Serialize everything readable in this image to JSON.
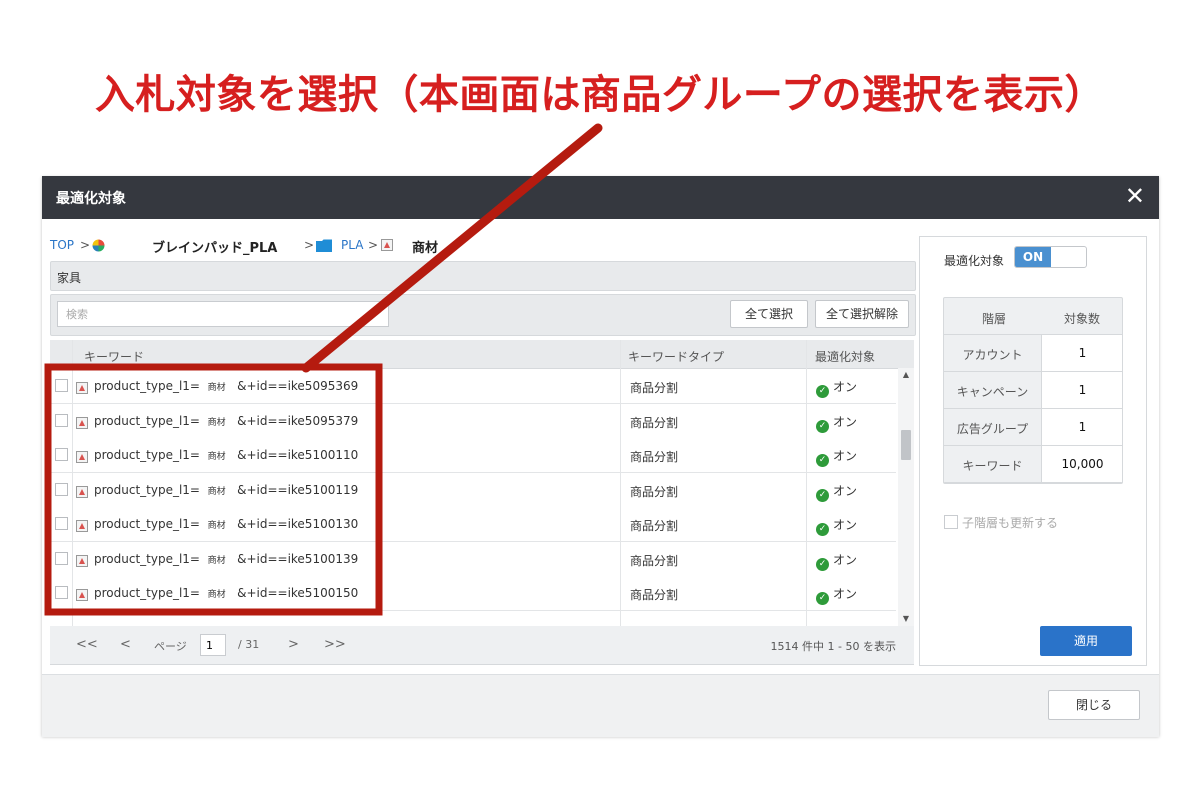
{
  "headline": {
    "text": "入札対象を選択（本画面は商品グループの選択を表示）",
    "color": "#d61f1f"
  },
  "modal": {
    "title": "最適化対象",
    "close_symbol": "✕"
  },
  "breadcrumb": {
    "top": "TOP",
    "sep": ">",
    "account": "ブレインパッド_PLA",
    "campaign": "PLA",
    "adgroup": "商材"
  },
  "category": "家具",
  "toolbar": {
    "search_placeholder": "検索",
    "select_all": "全て選択",
    "deselect_all": "全て選択解除"
  },
  "grid": {
    "headers": {
      "keyword": "キーワード",
      "type": "キーワードタイプ",
      "target": "最適化対象"
    },
    "rows": [
      {
        "kw_a": "product_type_l1=",
        "kw_b": "商材",
        "kw_c": "&+id==ike5095369",
        "type": "商品分割",
        "status": "オン"
      },
      {
        "kw_a": "product_type_l1=",
        "kw_b": "商材",
        "kw_c": "&+id==ike5095379",
        "type": "商品分割",
        "status": "オン"
      },
      {
        "kw_a": "product_type_l1=",
        "kw_b": "商材",
        "kw_c": "&+id==ike5100110",
        "type": "商品分割",
        "status": "オン"
      },
      {
        "kw_a": "product_type_l1=",
        "kw_b": "商材",
        "kw_c": "&+id==ike5100119",
        "type": "商品分割",
        "status": "オン"
      },
      {
        "kw_a": "product_type_l1=",
        "kw_b": "商材",
        "kw_c": "&+id==ike5100130",
        "type": "商品分割",
        "status": "オン"
      },
      {
        "kw_a": "product_type_l1=",
        "kw_b": "商材",
        "kw_c": "&+id==ike5100139",
        "type": "商品分割",
        "status": "オン"
      },
      {
        "kw_a": "product_type_l1=",
        "kw_b": "商材",
        "kw_c": "&+id==ike5100150",
        "type": "商品分割",
        "status": "オン"
      }
    ]
  },
  "pager": {
    "first": "<<",
    "prev": "<",
    "page_label": "ページ",
    "page": "1",
    "total": "/ 31",
    "next": ">",
    "last": ">>",
    "info": "1514 件中 1 - 50 を表示"
  },
  "side": {
    "label": "最適化対象",
    "toggle": "ON",
    "head_level": "階層",
    "head_count": "対象数",
    "rows": [
      {
        "level": "アカウント",
        "count": "1"
      },
      {
        "level": "キャンペーン",
        "count": "1"
      },
      {
        "level": "広告グループ",
        "count": "1"
      },
      {
        "level": "キーワード",
        "count": "10,000"
      }
    ],
    "child_option": "子階層も更新する",
    "apply": "適用"
  },
  "footer": {
    "close": "閉じる"
  },
  "icons": {
    "status": "check-circle-icon",
    "keyword": "product-group-icon",
    "folder": "folder-icon",
    "account": "color-wheel-icon"
  },
  "colors": {
    "accent_blue": "#2a73c9",
    "annotation_red": "#b51b0f",
    "header_dark": "#35383f",
    "status_green": "#2e9b3a"
  }
}
